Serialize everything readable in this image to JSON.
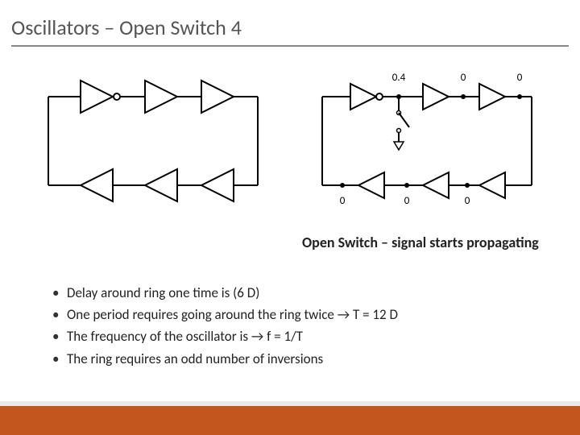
{
  "title": "Oscillators – Open Switch 4",
  "caption": "Open Switch – signal starts propagating",
  "bullets": [
    "Delay around ring one time is (6 D)",
    "One period requires going around the ring twice → T = 12 D",
    "The frequency of the oscillator is → f = 1/T",
    "The ring requires an odd number of inversions"
  ],
  "diagram": {
    "left": {
      "top_gates": 3,
      "bottom_gates": 3,
      "first_bubble": true
    },
    "right": {
      "top_gates": 3,
      "bottom_gates": 3,
      "first_bubble": true,
      "switch_open": true,
      "top_labels": [
        "0.4",
        "0",
        "0"
      ],
      "bottom_labels": [
        "0",
        "0",
        "0"
      ]
    }
  }
}
